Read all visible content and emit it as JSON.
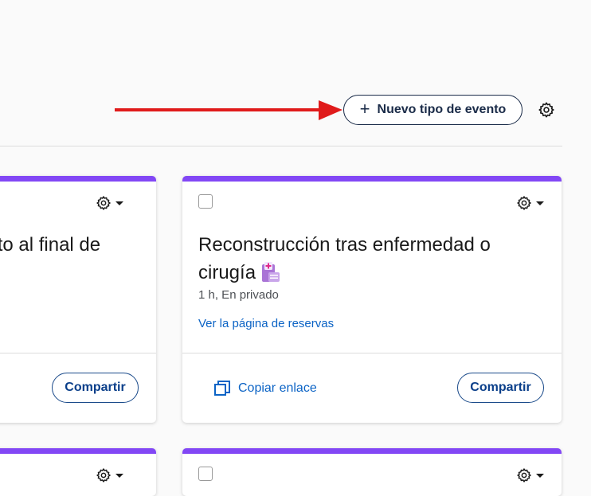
{
  "header": {
    "new_event_button": "Nuevo tipo de evento",
    "plus_icon": "plus-icon",
    "settings_icon": "gear-icon",
    "arrow_color": "#e01b1b"
  },
  "accent_color": "#8247f5",
  "cards": [
    {
      "title": "ento al final de",
      "share_label": "Compartir"
    },
    {
      "title": "Reconstrucción tras enfermedad o cirugía",
      "emoji_icon": "hospital-icon",
      "meta": "1 h, En privado",
      "booking_link": "Ver la página de reservas",
      "copy_link": "Copiar enlace",
      "share_label": "Compartir"
    }
  ]
}
